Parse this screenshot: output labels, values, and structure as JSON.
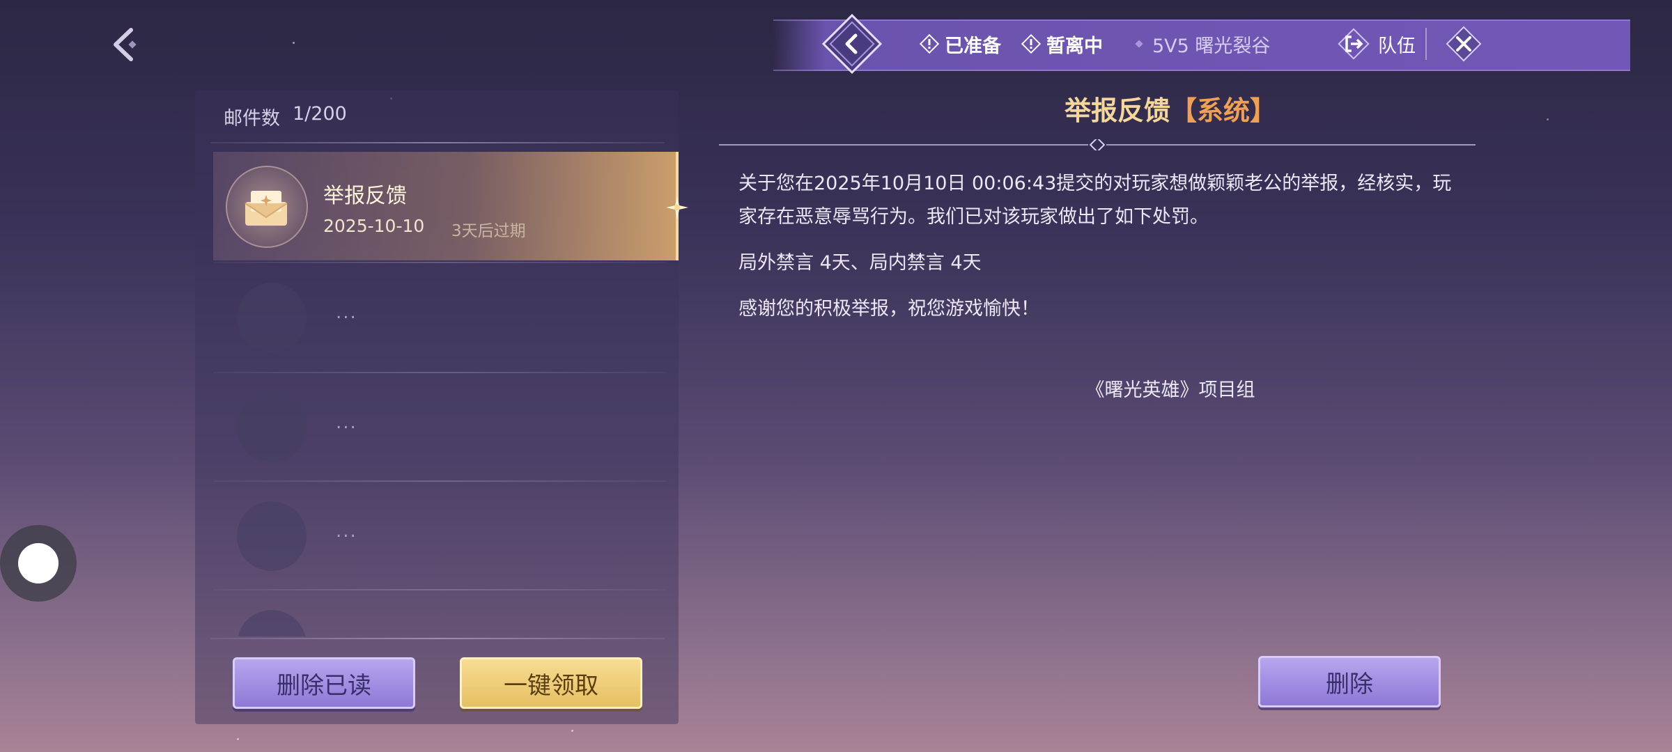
{
  "header": {
    "status_ready": "已准备",
    "status_away": "暂离中",
    "mode": "5V5 曙光裂谷",
    "team_label": "队伍"
  },
  "mailbox": {
    "count_label": "邮件数",
    "count_value": "1/200",
    "items": [
      {
        "title": "举报反馈",
        "date": "2025-10-10",
        "expire": "3天后过期"
      }
    ],
    "placeholder_text": "...",
    "delete_read_label": "删除已读",
    "claim_all_label": "一键领取"
  },
  "detail": {
    "title": "举报反馈",
    "tag": "【系统】",
    "body": [
      "关于您在2025年10月10日 00:06:43提交的对玩家想做颖颖老公的举报，经核实，玩家存在恶意辱骂行为。我们已对该玩家做出了如下处罚。",
      "局外禁言 4天、局内禁言 4天",
      "感谢您的积极举报，祝您游戏愉快！"
    ],
    "signature": "《曙光英雄》项目组",
    "delete_label": "删除"
  },
  "colors": {
    "accent_gold": "#f4d79b",
    "tag_orange": "#f0a054",
    "bar_purple": "#7258b6"
  }
}
